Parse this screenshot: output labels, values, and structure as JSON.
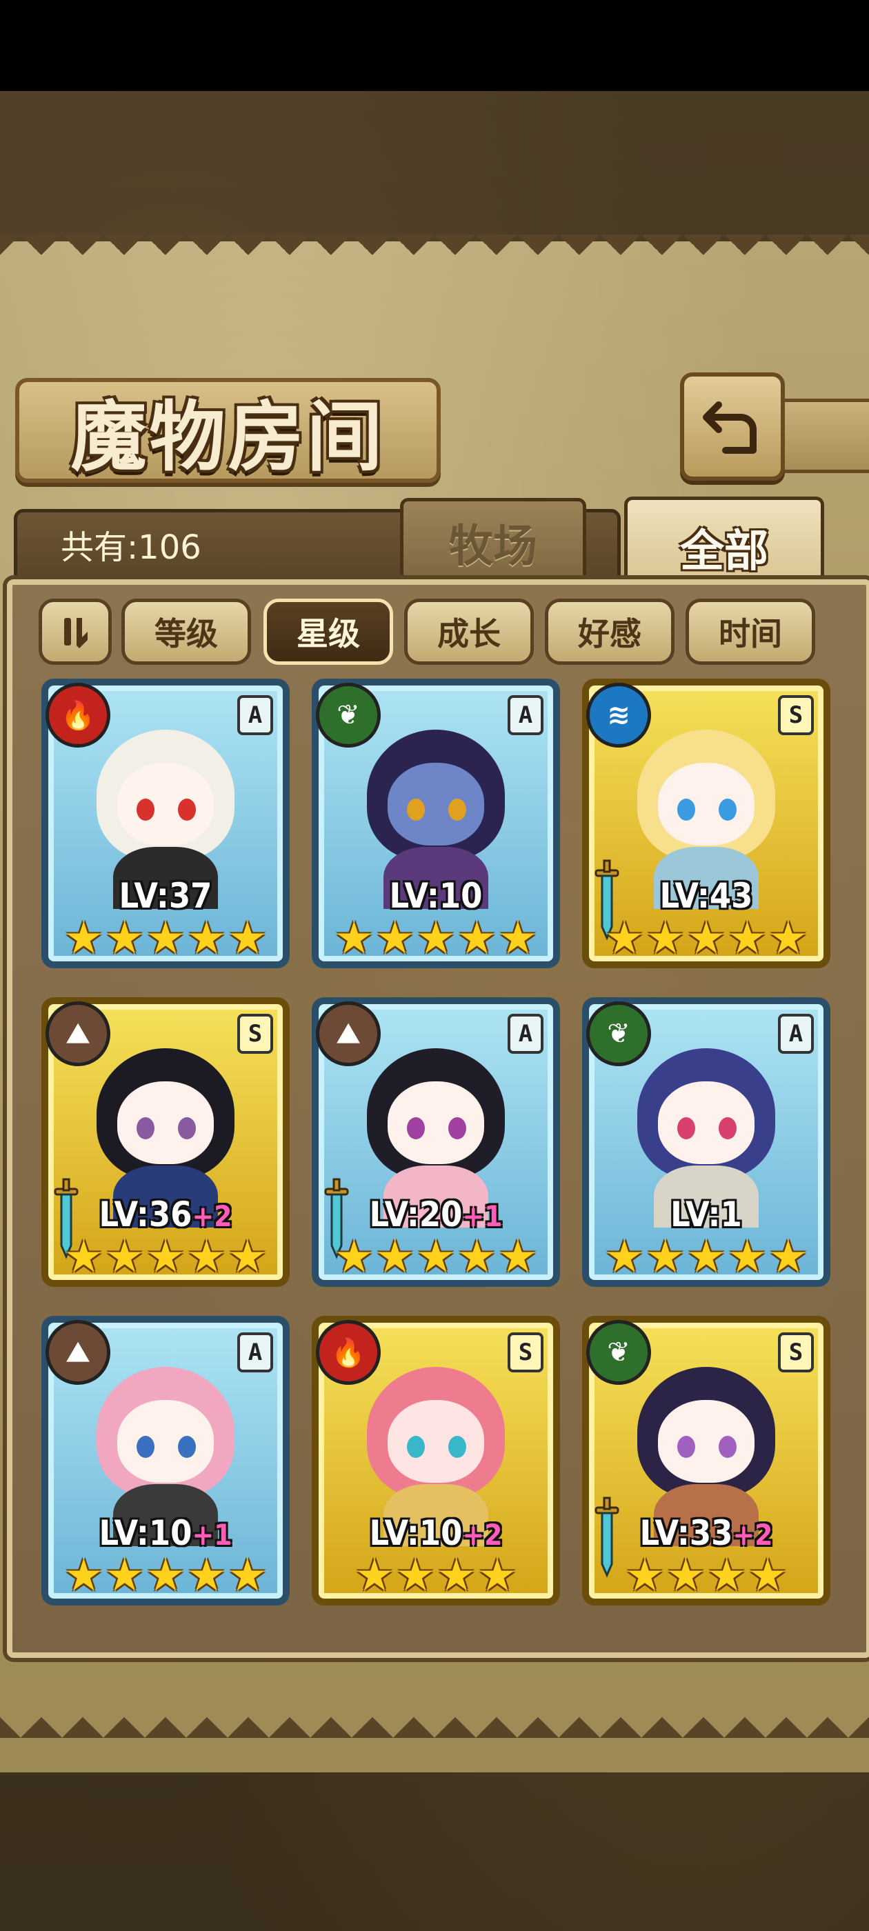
{
  "screen": {
    "title": "魔物房间",
    "count_label": "共有:106",
    "tabs": [
      {
        "label": "牧场",
        "active": false
      },
      {
        "label": "全部",
        "active": true
      }
    ],
    "sort_toggle_icon": "pause-sort-icon",
    "sort_options": [
      {
        "label": "等级",
        "active": false
      },
      {
        "label": "星级",
        "active": true
      },
      {
        "label": "成长",
        "active": false
      },
      {
        "label": "好感",
        "active": false
      },
      {
        "label": "时间",
        "active": false
      }
    ],
    "back_icon": "return-arrow-icon"
  },
  "colors": {
    "rank_A_frame": "#6bb4d6",
    "rank_S_frame": "#d4a418",
    "fire": "#c3231d",
    "leaf": "#2f6f2c",
    "water": "#1d78c4",
    "earth": "#6d4a35",
    "level_plus": "#ff5db8"
  },
  "monsters": [
    {
      "level": "LV:37",
      "plus": "",
      "rank": "A",
      "element": "fire",
      "stars": 5,
      "sword": false,
      "hair": "#f2efe6",
      "skin": "#fff3ee",
      "eye": "#d8322e",
      "outfit": "#2b2b2b"
    },
    {
      "level": "LV:10",
      "plus": "",
      "rank": "A",
      "element": "leaf",
      "stars": 5,
      "sword": false,
      "hair": "#2b2450",
      "skin": "#6e86c8",
      "eye": "#e0a020",
      "outfit": "#5a3a7a"
    },
    {
      "level": "LV:43",
      "plus": "",
      "rank": "S",
      "element": "water",
      "stars": 5,
      "sword": true,
      "hair": "#f7df8c",
      "skin": "#fff2ec",
      "eye": "#3a9be0",
      "outfit": "#9cc7d8"
    },
    {
      "level": "LV:36",
      "plus": "+2",
      "rank": "S",
      "element": "earth",
      "stars": 5,
      "sword": true,
      "hair": "#1c1a22",
      "skin": "#fff2ec",
      "eye": "#8a5aa0",
      "outfit": "#283c7a"
    },
    {
      "level": "LV:20",
      "plus": "+1",
      "rank": "A",
      "element": "earth",
      "stars": 5,
      "sword": true,
      "hair": "#1f1d28",
      "skin": "#fff2ec",
      "eye": "#a040a0",
      "outfit": "#f3b6c6"
    },
    {
      "level": "LV:1",
      "plus": "",
      "rank": "A",
      "element": "leaf",
      "stars": 5,
      "sword": false,
      "hair": "#3a3f8c",
      "skin": "#fff2ec",
      "eye": "#d84070",
      "outfit": "#d8d4c8"
    },
    {
      "level": "LV:10",
      "plus": "+1",
      "rank": "A",
      "element": "earth",
      "stars": 5,
      "sword": false,
      "hair": "#f2a7c0",
      "skin": "#fff2ec",
      "eye": "#3a70c0",
      "outfit": "#3a3a3a"
    },
    {
      "level": "LV:10",
      "plus": "+2",
      "rank": "S",
      "element": "fire",
      "stars": 4,
      "sword": false,
      "hair": "#ef7b8e",
      "skin": "#ffe4e4",
      "eye": "#38b8c8",
      "outfit": "#e4c060"
    },
    {
      "level": "LV:33",
      "plus": "+2",
      "rank": "S",
      "element": "leaf",
      "stars": 4,
      "sword": true,
      "hair": "#2c2446",
      "skin": "#fff2ec",
      "eye": "#a060c0",
      "outfit": "#b87048"
    }
  ]
}
